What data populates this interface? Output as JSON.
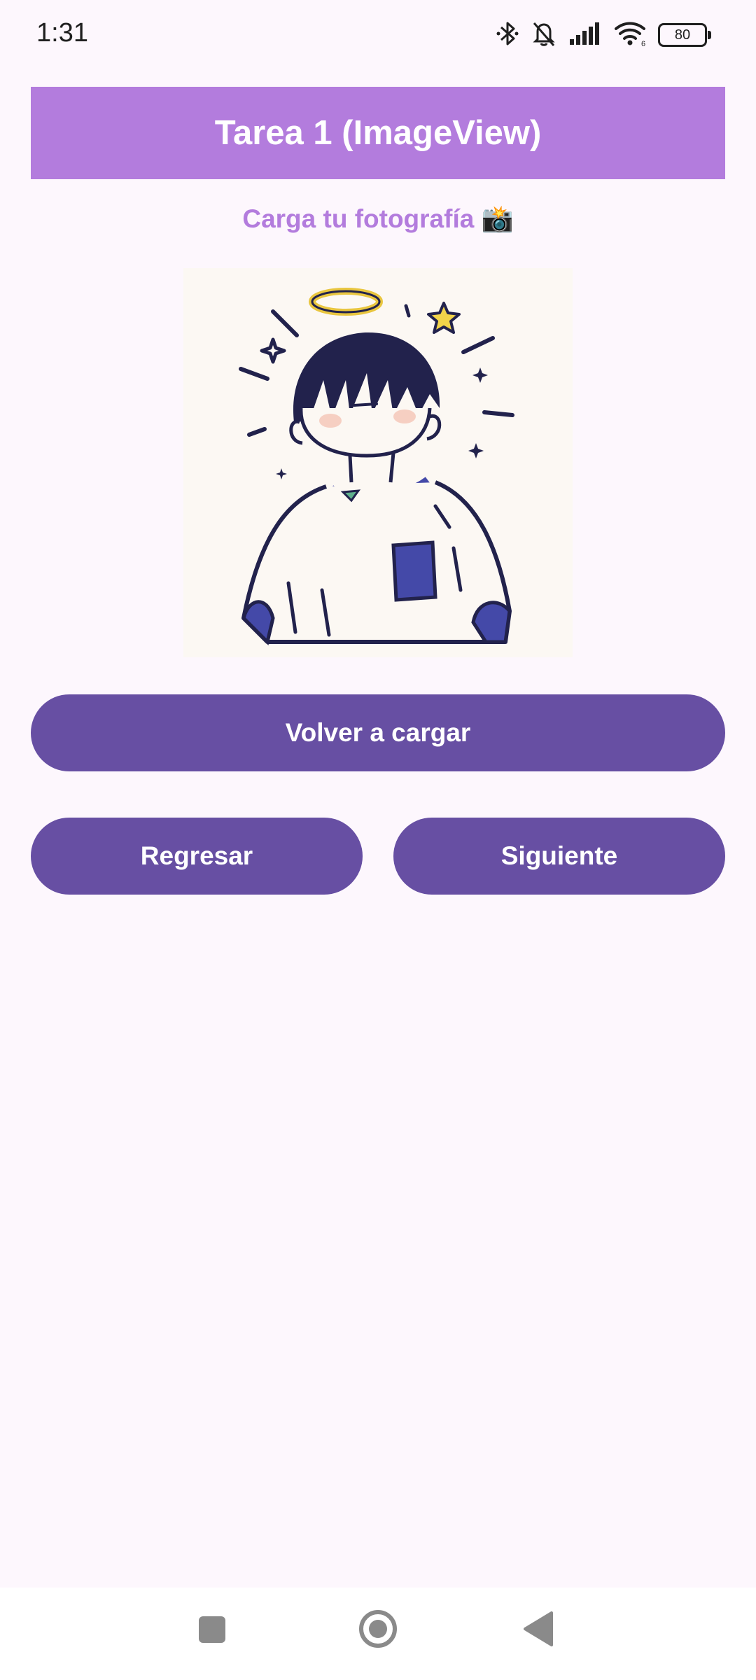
{
  "status_bar": {
    "time": "1:31",
    "battery_level": "80",
    "icons": [
      "bluetooth-icon",
      "bell-off-icon",
      "signal-icon",
      "wifi-icon",
      "battery-icon"
    ]
  },
  "header": {
    "title": "Tarea 1 (ImageView)"
  },
  "main": {
    "subtitle": "Carga tu fotografía 📸",
    "image_description_icon": "anime-boy-illustration",
    "buttons": {
      "reload_label": "Volver a cargar",
      "back_label": "Regresar",
      "next_label": "Siguiente"
    }
  },
  "nav_bar": {
    "icons": [
      "recents-icon",
      "home-icon",
      "back-icon"
    ]
  },
  "colors": {
    "background": "#fdf7fd",
    "header": "#b37cdd",
    "subtitle": "#b37cdd",
    "button": "#674fa3",
    "button_text": "#ffffff"
  }
}
